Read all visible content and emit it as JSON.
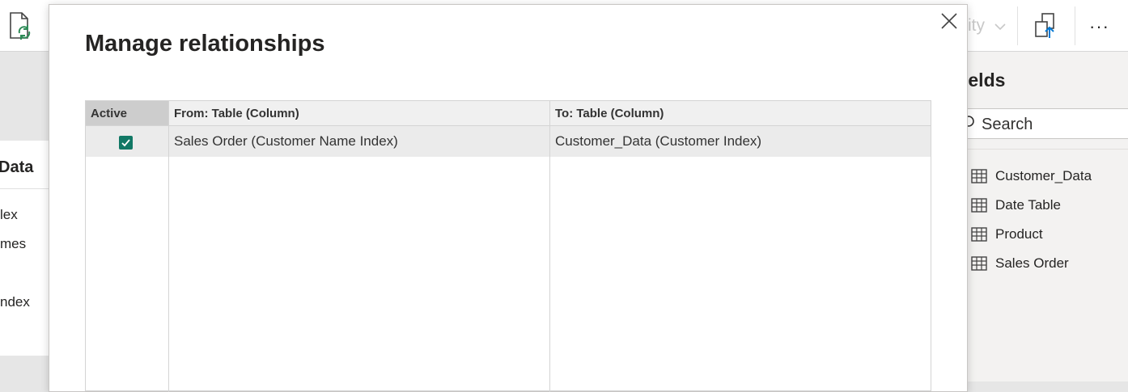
{
  "ribbon": {
    "refresh_icon": "refresh-data-icon",
    "faded_label": "ity",
    "publish_icon": "publish-icon",
    "more_label": "···"
  },
  "left_canvas": {
    "card_title": "Data",
    "fields": [
      "lex",
      "mes",
      "ndex"
    ]
  },
  "fields_pane": {
    "title": "ields",
    "search_placeholder": "Search",
    "tables": [
      {
        "name": "Customer_Data"
      },
      {
        "name": "Date Table"
      },
      {
        "name": "Product"
      },
      {
        "name": "Sales Order"
      }
    ]
  },
  "modal": {
    "title": "Manage relationships",
    "columns": {
      "active": "Active",
      "from": "From: Table (Column)",
      "to": "To: Table (Column)"
    },
    "rows": [
      {
        "active": true,
        "from": "Sales Order (Customer Name Index)",
        "to": "Customer_Data (Customer Index)"
      }
    ]
  },
  "colors": {
    "accent": "#117865",
    "selected_row": "#ebebeb",
    "header_bg": "#f0f0f0",
    "active_header_bg": "#cdcdcd"
  }
}
